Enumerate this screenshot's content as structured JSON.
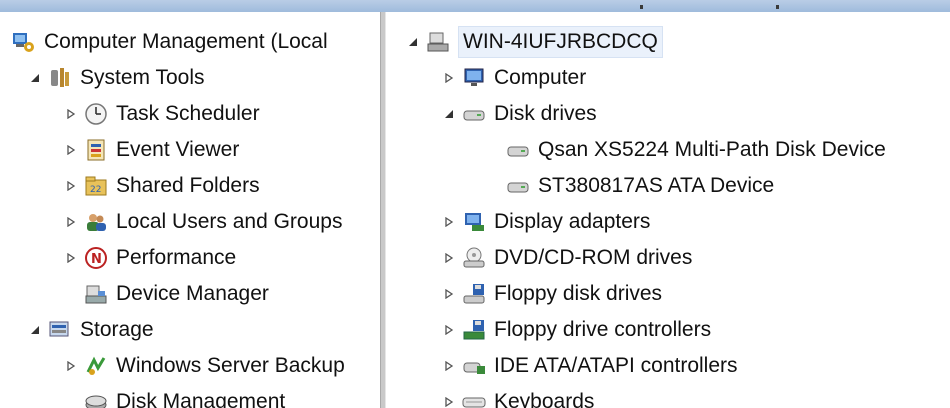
{
  "left_tree": {
    "root": {
      "label": "Computer Management (Local",
      "icon": "computer-management-icon"
    },
    "items": [
      {
        "label": "System Tools",
        "icon": "toolbox-icon",
        "expander": "expanded"
      },
      {
        "label": "Task Scheduler",
        "icon": "clock-icon",
        "expander": "collapsed"
      },
      {
        "label": "Event Viewer",
        "icon": "event-viewer-icon",
        "expander": "collapsed"
      },
      {
        "label": "Shared Folders",
        "icon": "shared-folder-icon",
        "expander": "collapsed"
      },
      {
        "label": "Local Users and Groups",
        "icon": "users-icon",
        "expander": "collapsed"
      },
      {
        "label": "Performance",
        "icon": "performance-icon",
        "expander": "collapsed"
      },
      {
        "label": "Device Manager",
        "icon": "device-manager-icon",
        "expander": "none"
      },
      {
        "label": "Storage",
        "icon": "storage-icon",
        "expander": "expanded"
      },
      {
        "label": "Windows Server Backup",
        "icon": "backup-icon",
        "expander": "collapsed"
      },
      {
        "label": "Disk Management",
        "icon": "disk-management-icon",
        "expander": "none"
      }
    ]
  },
  "right_tree": {
    "root": {
      "label": "WIN-4IUFJRBCDCQ",
      "icon": "computer-node-icon",
      "expander": "expanded"
    },
    "items": [
      {
        "label": "Computer",
        "icon": "monitor-icon",
        "expander": "collapsed"
      },
      {
        "label": "Disk drives",
        "icon": "disk-drive-icon",
        "expander": "expanded"
      },
      {
        "label": "Qsan XS5224  Multi-Path Disk Device",
        "icon": "disk-device-icon",
        "expander": "none"
      },
      {
        "label": "ST380817AS ATA Device",
        "icon": "disk-device-icon",
        "expander": "none"
      },
      {
        "label": "Display adapters",
        "icon": "display-adapter-icon",
        "expander": "collapsed"
      },
      {
        "label": "DVD/CD-ROM drives",
        "icon": "dvd-drive-icon",
        "expander": "collapsed"
      },
      {
        "label": "Floppy disk drives",
        "icon": "floppy-drive-icon",
        "expander": "collapsed"
      },
      {
        "label": "Floppy drive controllers",
        "icon": "floppy-controller-icon",
        "expander": "collapsed"
      },
      {
        "label": "IDE ATA/ATAPI controllers",
        "icon": "ide-controller-icon",
        "expander": "collapsed"
      },
      {
        "label": "Keyboards",
        "icon": "keyboard-icon",
        "expander": "collapsed"
      }
    ]
  }
}
